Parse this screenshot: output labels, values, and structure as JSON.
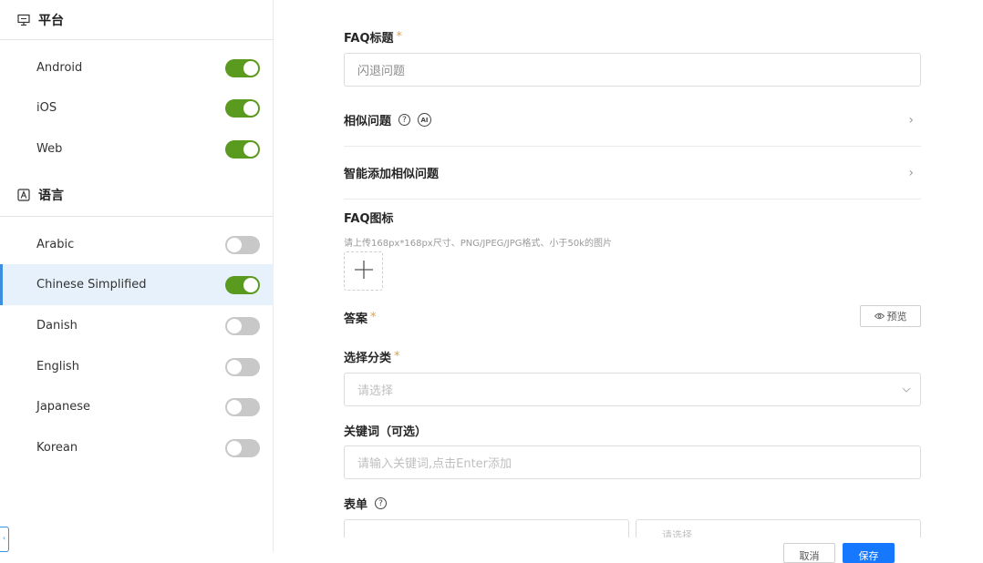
{
  "sidebar": {
    "platform_header": "平台",
    "platforms": [
      {
        "label": "Android",
        "on": true
      },
      {
        "label": "iOS",
        "on": true
      },
      {
        "label": "Web",
        "on": true
      }
    ],
    "language_header": "语言",
    "languages": [
      {
        "label": "Arabic",
        "on": false
      },
      {
        "label": "Chinese Simplified",
        "on": true,
        "active": true
      },
      {
        "label": "Danish",
        "on": false
      },
      {
        "label": "English",
        "on": false
      },
      {
        "label": "Japanese",
        "on": false
      },
      {
        "label": "Korean",
        "on": false
      }
    ],
    "edge_tab_label": "‹"
  },
  "form": {
    "faq_title_label": "FAQ标题",
    "required_mark": "*",
    "faq_title_value": "闪退问题",
    "similar_label": "相似问题",
    "ai_badge": "AI",
    "smart_add_label": "智能添加相似问题",
    "faq_icon_label": "FAQ图标",
    "faq_icon_hint": "请上传168px*168px尺寸、PNG/JPEG/JPG格式、小于50k的图片",
    "answer_label": "答案",
    "preview_button": "预览",
    "category_label": "选择分类",
    "category_placeholder": "请选择",
    "keywords_label": "关键词（可选）",
    "keywords_placeholder": "请输入关键词,点击Enter添加",
    "form_label": "表单",
    "form_select_placeholder": "请选择",
    "cancel_button": "取消",
    "save_button": "保存"
  },
  "colors": {
    "toggle_on": "#5a9a1f",
    "toggle_off": "#c8c8c8",
    "active_row_bg": "#e6f1fc",
    "active_row_border": "#3d8ee0",
    "required": "#e0a145",
    "primary": "#1677ff"
  }
}
